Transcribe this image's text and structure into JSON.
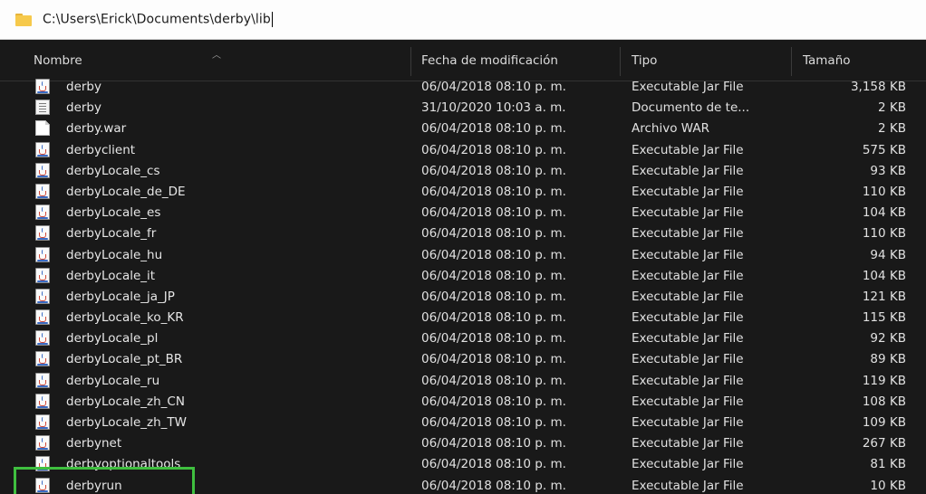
{
  "address_bar": {
    "path": "C:\\Users\\Erick\\Documents\\derby\\lib"
  },
  "columns": {
    "name": "Nombre",
    "date": "Fecha de modificación",
    "type": "Tipo",
    "size": "Tamaño"
  },
  "icons": {
    "folder": "folder-icon",
    "jar": "jar-file-icon",
    "txt": "text-document-icon",
    "war": "blank-file-icon",
    "sort": "sort-up-icon"
  },
  "colors": {
    "highlight": "#3fbf3f",
    "background": "#191919"
  },
  "files": [
    {
      "name": "derby",
      "date": "06/04/2018 08:10 p. m.",
      "type": "Executable Jar File",
      "size": "3,158 KB",
      "icon": "jar"
    },
    {
      "name": "derby",
      "date": "31/10/2020 10:03 a. m.",
      "type": "Documento de te...",
      "size": "2 KB",
      "icon": "txt"
    },
    {
      "name": "derby.war",
      "date": "06/04/2018 08:10 p. m.",
      "type": "Archivo WAR",
      "size": "2 KB",
      "icon": "war"
    },
    {
      "name": "derbyclient",
      "date": "06/04/2018 08:10 p. m.",
      "type": "Executable Jar File",
      "size": "575 KB",
      "icon": "jar"
    },
    {
      "name": "derbyLocale_cs",
      "date": "06/04/2018 08:10 p. m.",
      "type": "Executable Jar File",
      "size": "93 KB",
      "icon": "jar"
    },
    {
      "name": "derbyLocale_de_DE",
      "date": "06/04/2018 08:10 p. m.",
      "type": "Executable Jar File",
      "size": "110 KB",
      "icon": "jar"
    },
    {
      "name": "derbyLocale_es",
      "date": "06/04/2018 08:10 p. m.",
      "type": "Executable Jar File",
      "size": "104 KB",
      "icon": "jar"
    },
    {
      "name": "derbyLocale_fr",
      "date": "06/04/2018 08:10 p. m.",
      "type": "Executable Jar File",
      "size": "110 KB",
      "icon": "jar"
    },
    {
      "name": "derbyLocale_hu",
      "date": "06/04/2018 08:10 p. m.",
      "type": "Executable Jar File",
      "size": "94 KB",
      "icon": "jar"
    },
    {
      "name": "derbyLocale_it",
      "date": "06/04/2018 08:10 p. m.",
      "type": "Executable Jar File",
      "size": "104 KB",
      "icon": "jar"
    },
    {
      "name": "derbyLocale_ja_JP",
      "date": "06/04/2018 08:10 p. m.",
      "type": "Executable Jar File",
      "size": "121 KB",
      "icon": "jar"
    },
    {
      "name": "derbyLocale_ko_KR",
      "date": "06/04/2018 08:10 p. m.",
      "type": "Executable Jar File",
      "size": "115 KB",
      "icon": "jar"
    },
    {
      "name": "derbyLocale_pl",
      "date": "06/04/2018 08:10 p. m.",
      "type": "Executable Jar File",
      "size": "92 KB",
      "icon": "jar"
    },
    {
      "name": "derbyLocale_pt_BR",
      "date": "06/04/2018 08:10 p. m.",
      "type": "Executable Jar File",
      "size": "89 KB",
      "icon": "jar"
    },
    {
      "name": "derbyLocale_ru",
      "date": "06/04/2018 08:10 p. m.",
      "type": "Executable Jar File",
      "size": "119 KB",
      "icon": "jar"
    },
    {
      "name": "derbyLocale_zh_CN",
      "date": "06/04/2018 08:10 p. m.",
      "type": "Executable Jar File",
      "size": "108 KB",
      "icon": "jar"
    },
    {
      "name": "derbyLocale_zh_TW",
      "date": "06/04/2018 08:10 p. m.",
      "type": "Executable Jar File",
      "size": "109 KB",
      "icon": "jar"
    },
    {
      "name": "derbynet",
      "date": "06/04/2018 08:10 p. m.",
      "type": "Executable Jar File",
      "size": "267 KB",
      "icon": "jar"
    },
    {
      "name": "derbyoptionaltools",
      "date": "06/04/2018 08:10 p. m.",
      "type": "Executable Jar File",
      "size": "81 KB",
      "icon": "jar"
    },
    {
      "name": "derbyrun",
      "date": "06/04/2018 08:10 p. m.",
      "type": "Executable Jar File",
      "size": "10 KB",
      "icon": "jar"
    }
  ]
}
